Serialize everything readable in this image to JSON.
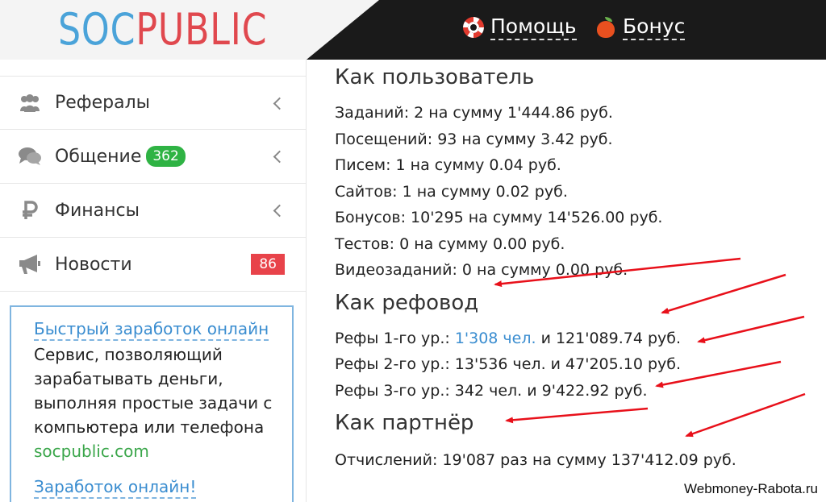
{
  "header": {
    "logo_part1": "SOC",
    "logo_part2": "PUBLIC",
    "help_label": "Помощь",
    "bonus_label": "Бонус"
  },
  "sidebar": {
    "items": [
      {
        "label": "Рефералы",
        "icon": "users-icon"
      },
      {
        "label": "Общение",
        "icon": "chat-icon",
        "badge": "362"
      },
      {
        "label": "Финансы",
        "icon": "ruble-icon"
      },
      {
        "label": "Новости",
        "icon": "megaphone-icon",
        "badge": "86"
      }
    ],
    "ad": {
      "title": "Быстрый заработок онлайн",
      "text": "Сервис, позволяющий зарабатывать деньги, выполняя простые задачи с компьютера или телефона",
      "url": "socpublic.com",
      "title2": "Заработок онлайн!"
    }
  },
  "main": {
    "as_user": {
      "title": "Как пользователь",
      "lines": [
        "Заданий: 2 на сумму 1'444.86 руб.",
        "Посещений: 93 на сумму 3.42 руб.",
        "Писем: 1 на сумму 0.04 руб.",
        "Сайтов: 1 на сумму 0.02 руб.",
        "Бонусов: 10'295 на сумму 14'526.00 руб.",
        "Тестов: 0 на сумму 0.00 руб.",
        "Видеозаданий: 0 на сумму 0.00 руб."
      ]
    },
    "as_referrer": {
      "title": "Как рефовод",
      "level1_prefix": "Рефы 1-го ур.: ",
      "level1_link": "1'308 чел.",
      "level1_suffix": " и 121'089.74 руб.",
      "level2": "Рефы 2-го ур.: 13'536 чел. и 47'205.10 руб.",
      "level3": "Рефы 3-го ур.: 342 чел. и 9'422.92 руб."
    },
    "as_partner": {
      "title": "Как партнёр",
      "line": "Отчислений: 19'087 раз на сумму 137'412.09 руб."
    }
  },
  "watermark": "Webmoney-Rabota.ru",
  "colors": {
    "logo_blue": "#4aa3d9",
    "logo_red": "#e0484e",
    "topbar": "#1a1a1a",
    "badge_green": "#2fb344",
    "badge_red": "#e8434a",
    "link_blue": "#3a8dd0",
    "arrow_red": "#e8101a"
  }
}
